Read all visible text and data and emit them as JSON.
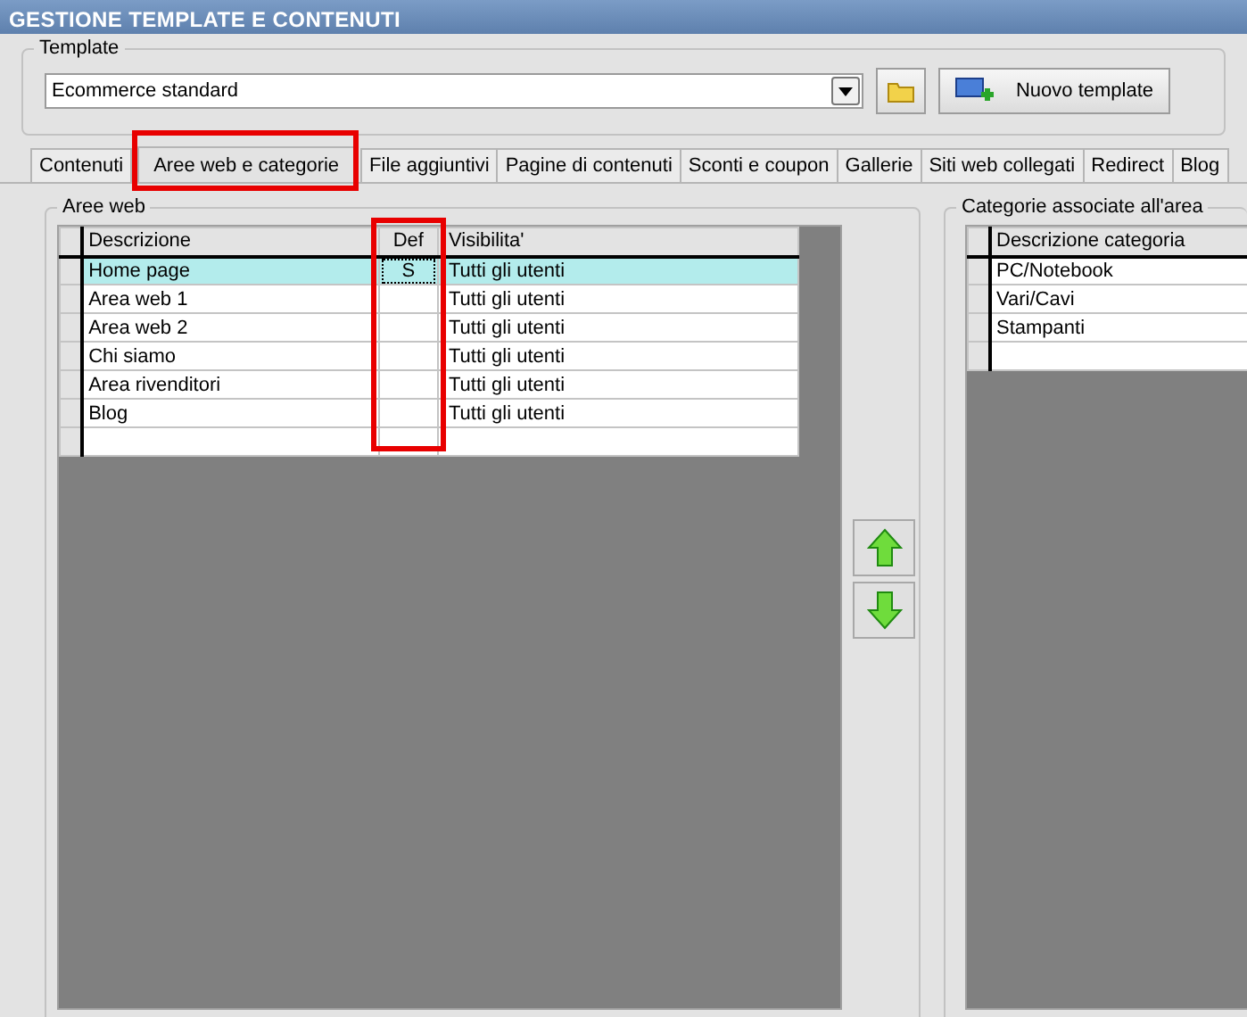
{
  "window": {
    "title": "GESTIONE TEMPLATE E CONTENUTI"
  },
  "template": {
    "label": "Template",
    "value": "Ecommerce standard",
    "new_button": "Nuovo template"
  },
  "tabs": [
    {
      "label": "Contenuti",
      "selected": false,
      "highlighted": false
    },
    {
      "label": "Aree web e categorie",
      "selected": true,
      "highlighted": true
    },
    {
      "label": "File aggiuntivi",
      "selected": false,
      "highlighted": false
    },
    {
      "label": "Pagine di contenuti",
      "selected": false,
      "highlighted": false
    },
    {
      "label": "Sconti e coupon",
      "selected": false,
      "highlighted": false
    },
    {
      "label": "Gallerie",
      "selected": false,
      "highlighted": false
    },
    {
      "label": "Siti web collegati",
      "selected": false,
      "highlighted": false
    },
    {
      "label": "Redirect",
      "selected": false,
      "highlighted": false
    },
    {
      "label": "Blog",
      "selected": false,
      "highlighted": false
    }
  ],
  "areas": {
    "title": "Aree web",
    "columns": [
      {
        "label": "Descrizione",
        "highlighted": false
      },
      {
        "label": "Def",
        "highlighted": true
      },
      {
        "label": "Visibilita'",
        "highlighted": false
      }
    ],
    "rows": [
      {
        "cells": [
          "Home page",
          "S",
          "Tutti gli utenti"
        ],
        "selected": true
      },
      {
        "cells": [
          "Area web 1",
          "",
          "Tutti gli utenti"
        ],
        "selected": false
      },
      {
        "cells": [
          "Area web 2",
          "",
          "Tutti gli utenti"
        ],
        "selected": false
      },
      {
        "cells": [
          "Chi siamo",
          "",
          "Tutti gli utenti"
        ],
        "selected": false
      },
      {
        "cells": [
          "Area rivenditori",
          "",
          "Tutti gli utenti"
        ],
        "selected": false
      },
      {
        "cells": [
          "Blog",
          "",
          "Tutti gli utenti"
        ],
        "selected": false
      }
    ]
  },
  "categories": {
    "title": "Categorie associate all'area",
    "column": "Descrizione categoria",
    "rows": [
      "PC/Notebook",
      "Vari/Cavi",
      "Stampanti"
    ]
  }
}
